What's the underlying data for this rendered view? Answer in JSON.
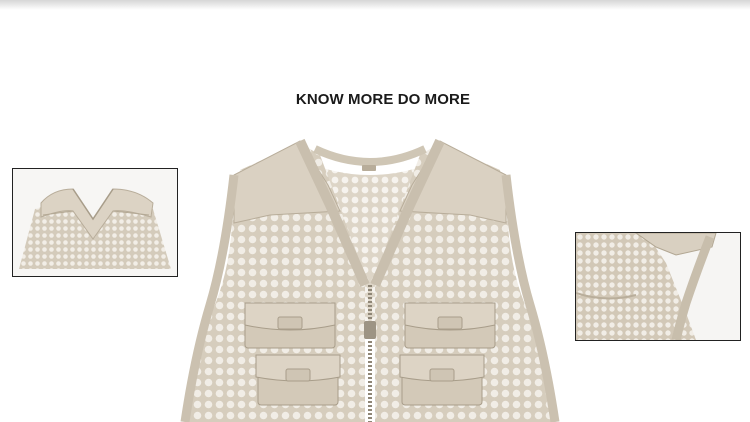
{
  "headline": "KNOW MORE DO MORE",
  "colors": {
    "background": "#ffffff",
    "fabric": "#d9d0c1",
    "fabric_shadow": "#b8ad9a",
    "mesh_hole": "#f1ede6",
    "frame_border": "#222222"
  },
  "images": [
    {
      "name": "vest-main",
      "subject": "khaki mesh multi-pocket vest"
    },
    {
      "name": "detail-left",
      "subject": "vest back collar close-up"
    },
    {
      "name": "detail-right",
      "subject": "mesh armhole close-up"
    }
  ]
}
